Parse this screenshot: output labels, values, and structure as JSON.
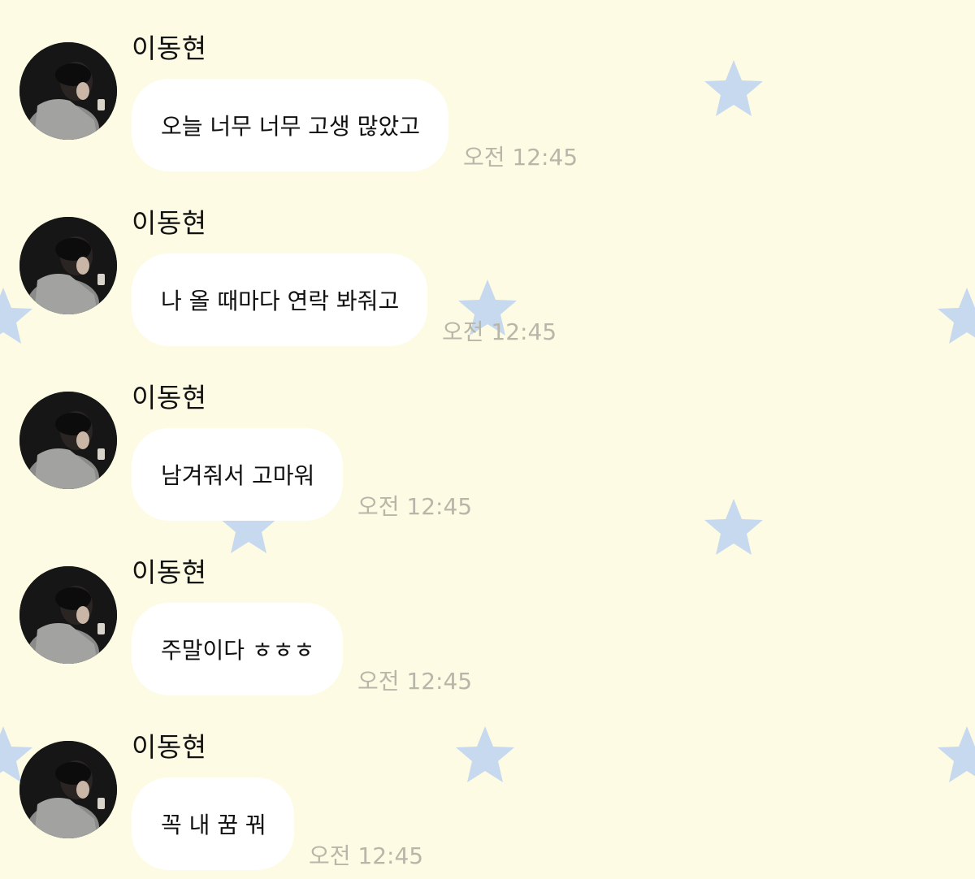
{
  "theme": {
    "background": "#fdfbe3",
    "star_color": "#c6d9ee",
    "bubble_color": "#ffffff",
    "time_color": "#b8b6a8"
  },
  "messages": [
    {
      "sender": "이동현",
      "text": "오늘 너무 너무 고생 많았고",
      "time": "오전 12:45"
    },
    {
      "sender": "이동현",
      "text": "나 올 때마다 연락 봐줘고",
      "time": "오전 12:45"
    },
    {
      "sender": "이동현",
      "text": "남겨줘서 고마워",
      "time": "오전 12:45"
    },
    {
      "sender": "이동현",
      "text": "주말이다 ㅎㅎㅎ",
      "time": "오전 12:45"
    },
    {
      "sender": "이동현",
      "text": "꼭 내 꿈 꿔",
      "time": "오전 12:45"
    }
  ]
}
